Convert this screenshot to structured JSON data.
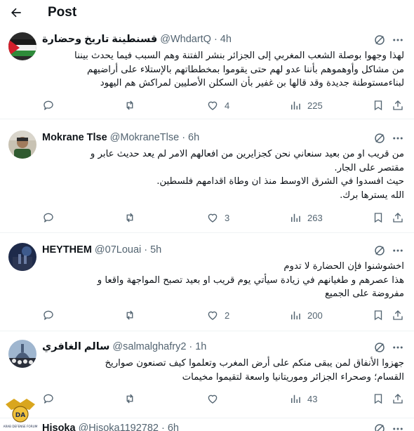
{
  "header": {
    "title": "Post"
  },
  "colors": {
    "text": "#0f1419",
    "muted": "#536471",
    "divider": "#eff3f4"
  },
  "tweets": [
    {
      "name": "قسنطينة تاريخ وحضارة",
      "handle": "@WhdartQ",
      "time": "4h",
      "lines": [
        "لهذا وجهوا بوصلة الشعب المغربي إلى الجزائر بنشر الفتنة وهم السبب فيما يحدث بيننا",
        "من مشاكل وأوهموهم بأننا عدو لهم حتى يقوموا بمخططاتهم بالإستلاء على أراضيهم",
        "لبناءمستوطنة جديدة وقد قالها بن غفير بأن السكلن الأصليين لمراكش هم اليهود"
      ],
      "replies": "",
      "retweets": "",
      "likes": "4",
      "views": "225"
    },
    {
      "name": "Mokrane Tlse",
      "handle": "@MokraneTlse",
      "time": "6h",
      "lines": [
        "من قريب او من بعيد سنعاني نحن كجزايرين من افعالهم الامر لم يعد حديث عابر و",
        "مقتصر على الجار.",
        "حيث افسدوا في الشرق الاوسط منذ ان وطاة اقدامهم فلسطين.",
        "الله يسترها برك."
      ],
      "replies": "",
      "retweets": "",
      "likes": "3",
      "views": "263"
    },
    {
      "name": "HEYTHEM",
      "handle": "@07Louai",
      "time": "5h",
      "lines": [
        "اخشوشنوا فإن الحضارة لا تدوم",
        "هذا عصرهم و طغيانهم في زيادة سيأتي يوم قريب او بعيد تصبح المواجهة واقعا و",
        "مفروضة على الجميع"
      ],
      "replies": "",
      "retweets": "",
      "likes": "2",
      "views": "200"
    },
    {
      "name": "سالم الغافري",
      "handle": "@salmalghafry2",
      "time": "1h",
      "lines": [
        "جهزوا  الأنفاق لمن يبقى منكم على أرض المغرب وتعلموا كيف تصنعون صواريخ",
        "القسام؛ وصحراء الجزائر وموريتانيا واسعة لتقيموا مخيمات"
      ],
      "replies": "",
      "retweets": "",
      "likes": "",
      "views": "43"
    },
    {
      "name": "Hisoka",
      "handle": "@Hisoka1192782",
      "time": "6h",
      "lines": [],
      "replies": "",
      "retweets": "",
      "likes": "",
      "views": ""
    }
  ],
  "watermark": {
    "line1": "ARAB DEFENSE FORUM",
    "logo_text": "DA"
  }
}
